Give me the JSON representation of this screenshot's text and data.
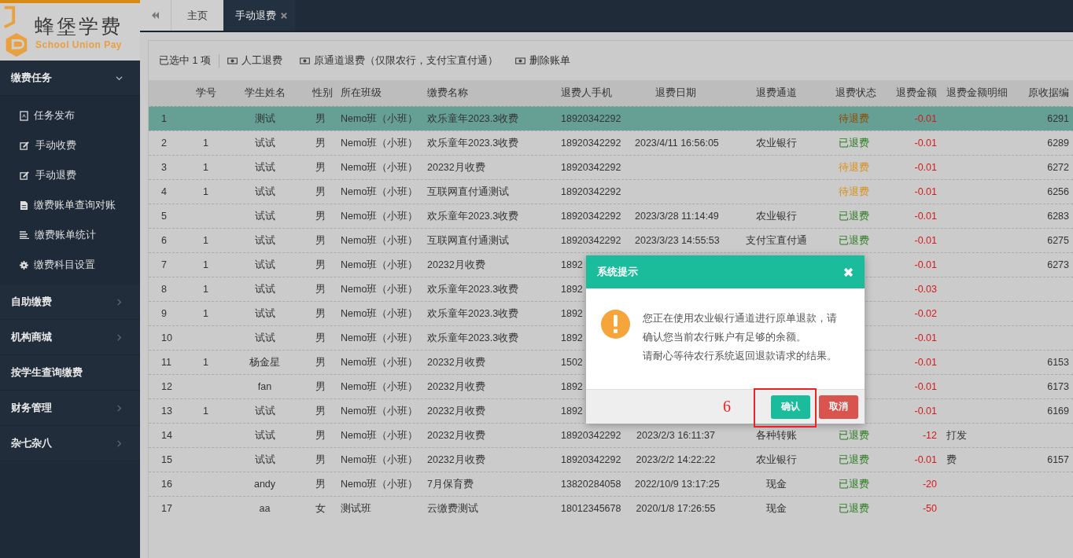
{
  "logo": {
    "title": "蜂堡学费",
    "subtitle": "School Union Pay"
  },
  "sidebar": {
    "groups": [
      {
        "label": "缴费任务",
        "kind": "expandable",
        "expanded": true,
        "children": [
          {
            "label": "任务发布"
          },
          {
            "label": "手动收费"
          },
          {
            "label": "手动退费"
          },
          {
            "label": "缴费账单查询对账"
          },
          {
            "label": "缴费账单统计"
          },
          {
            "label": "缴费科目设置"
          }
        ]
      },
      {
        "label": "自助缴费",
        "kind": "expandable",
        "expanded": false
      },
      {
        "label": "机构商城",
        "kind": "expandable",
        "expanded": false
      },
      {
        "label": "按学生查询缴费",
        "kind": "link"
      },
      {
        "label": "财务管理",
        "kind": "expandable",
        "expanded": false
      },
      {
        "label": "杂七杂八",
        "kind": "expandable",
        "expanded": false
      }
    ]
  },
  "tabs": [
    {
      "label": "主页",
      "selected": false,
      "closable": false
    },
    {
      "label": "手动退费",
      "selected": true,
      "closable": true
    }
  ],
  "toolbar": {
    "selection": "已选中 1 项",
    "actions": [
      "人工退费",
      "原通道退费（仅限农行，支付宝直付通）",
      "删除账单"
    ]
  },
  "table": {
    "columns": [
      "",
      "学号",
      "学生姓名",
      "性别",
      "所在班级",
      "缴费名称",
      "退费人手机",
      "退费日期",
      "退费通道",
      "退费状态",
      "退费金额",
      "退费金额明细",
      "原收据编"
    ],
    "rows": [
      {
        "selected": true,
        "cells": [
          "1",
          "",
          "测试",
          "男",
          "Nemo班（小班）",
          "欢乐童年2023.3收费",
          "18920342292",
          "",
          "",
          {
            "text": "待退费",
            "kind": "pending"
          },
          "-0.01",
          "",
          "6291"
        ]
      },
      {
        "selected": false,
        "cells": [
          "2",
          "1",
          "试试",
          "男",
          "Nemo班（小班）",
          "欢乐童年2023.3收费",
          "18920342292",
          "2023/4/11 16:56:05",
          "农业银行",
          {
            "text": "已退费",
            "kind": "done"
          },
          "-0.01",
          "",
          "6289"
        ]
      },
      {
        "selected": false,
        "cells": [
          "3",
          "1",
          "试试",
          "男",
          "Nemo班（小班）",
          "20232月收费",
          "18920342292",
          "",
          "",
          {
            "text": "待退费",
            "kind": "pending"
          },
          "-0.01",
          "",
          "6272"
        ]
      },
      {
        "selected": false,
        "cells": [
          "4",
          "1",
          "试试",
          "男",
          "Nemo班（小班）",
          "互联网直付通测试",
          "18920342292",
          "",
          "",
          {
            "text": "待退费",
            "kind": "pending"
          },
          "-0.01",
          "",
          "6256"
        ]
      },
      {
        "selected": false,
        "cells": [
          "5",
          "",
          "试试",
          "男",
          "Nemo班（小班）",
          "欢乐童年2023.3收费",
          "18920342292",
          "2023/3/28 11:14:49",
          "农业银行",
          {
            "text": "已退费",
            "kind": "done"
          },
          "-0.01",
          "",
          "6283"
        ]
      },
      {
        "selected": false,
        "cells": [
          "6",
          "1",
          "试试",
          "男",
          "Nemo班（小班）",
          "互联网直付通测试",
          "18920342292",
          "2023/3/23 14:55:53",
          "支付宝直付通",
          {
            "text": "已退费",
            "kind": "done"
          },
          "-0.01",
          "",
          "6275"
        ]
      },
      {
        "selected": false,
        "cells": [
          "7",
          "1",
          "试试",
          "男",
          "Nemo班（小班）",
          "20232月收费",
          "1892",
          "",
          "",
          "",
          "-0.01",
          "",
          "6273"
        ]
      },
      {
        "selected": false,
        "cells": [
          "8",
          "1",
          "试试",
          "男",
          "Nemo班（小班）",
          "欢乐童年2023.3收费",
          "1892",
          "",
          "",
          "",
          "-0.03",
          "",
          ""
        ]
      },
      {
        "selected": false,
        "cells": [
          "9",
          "1",
          "试试",
          "男",
          "Nemo班（小班）",
          "欢乐童年2023.3收费",
          "1892",
          "",
          "",
          "",
          "-0.02",
          "",
          ""
        ]
      },
      {
        "selected": false,
        "cells": [
          "10",
          "",
          "试试",
          "男",
          "Nemo班（小班）",
          "欢乐童年2023.3收费",
          "1892",
          "",
          "",
          "",
          "-0.01",
          "",
          ""
        ]
      },
      {
        "selected": false,
        "cells": [
          "11",
          "1",
          "杨金星",
          "男",
          "Nemo班（小班）",
          "20232月收费",
          "1502",
          "",
          "",
          "",
          "-0.01",
          "",
          "6153"
        ]
      },
      {
        "selected": false,
        "cells": [
          "12",
          "",
          "fan",
          "男",
          "Nemo班（小班）",
          "20232月收费",
          "1892",
          "",
          "",
          "",
          "-0.01",
          "",
          "6173"
        ]
      },
      {
        "selected": false,
        "cells": [
          "13",
          "1",
          "试试",
          "男",
          "Nemo班（小班）",
          "20232月收费",
          "1892",
          "",
          "",
          "",
          "-0.01",
          "",
          "6169"
        ]
      },
      {
        "selected": false,
        "cells": [
          "14",
          "",
          "试试",
          "男",
          "Nemo班（小班）",
          "20232月收费",
          "18920342292",
          "2023/2/3 16:11:37",
          "各种转账",
          {
            "text": "已退费",
            "kind": "done"
          },
          "-12",
          "打发",
          ""
        ]
      },
      {
        "selected": false,
        "cells": [
          "15",
          "",
          "试试",
          "男",
          "Nemo班（小班）",
          "20232月收费",
          "18920342292",
          "2023/2/2 14:22:22",
          "农业银行",
          {
            "text": "已退费",
            "kind": "done"
          },
          "-0.01",
          "费",
          "6157"
        ]
      },
      {
        "selected": false,
        "cells": [
          "16",
          "",
          "andy",
          "男",
          "Nemo班（小班）",
          "7月保育费",
          "13820284058",
          "2022/10/9 13:17:25",
          "现金",
          {
            "text": "已退费",
            "kind": "done"
          },
          "-20",
          "",
          ""
        ]
      },
      {
        "selected": false,
        "cells": [
          "17",
          "",
          "aa",
          "女",
          "测试班",
          "云缴费测试",
          "18012345678",
          "2020/1/8 17:26:55",
          "现金",
          {
            "text": "已退费",
            "kind": "done"
          },
          "-50",
          "",
          ""
        ]
      }
    ]
  },
  "dialog": {
    "title": "系统提示",
    "message": "您正在使用农业银行通道进行原单退款，请确认您当前农行账户有足够的余额。",
    "note": "请耐心等待农行系统返回退款请求的结果。",
    "buttons": [
      {
        "label": "确认",
        "kind": "primary"
      },
      {
        "label": "取消",
        "kind": "danger"
      }
    ]
  },
  "annotation": {
    "label": "6"
  }
}
